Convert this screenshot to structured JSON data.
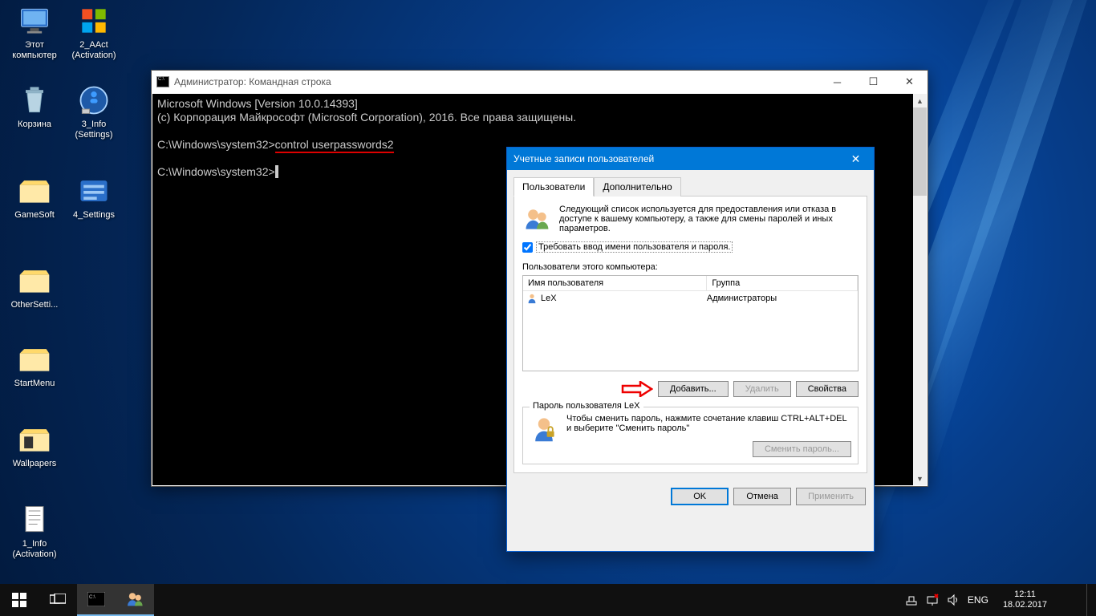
{
  "desktop_icons": [
    {
      "label": "Этот компьютер"
    },
    {
      "label": "2_AAct (Activation)"
    },
    {
      "label": "Корзина"
    },
    {
      "label": "3_Info (Settings)"
    },
    {
      "label": "GameSoft"
    },
    {
      "label": "4_Settings"
    },
    {
      "label": "OtherSetti..."
    },
    {
      "label": "StartMenu"
    },
    {
      "label": "Wallpapers"
    },
    {
      "label": "1_Info (Activation)"
    }
  ],
  "cmd": {
    "title": "Администратор: Командная строка",
    "line1": "Microsoft Windows [Version 10.0.14393]",
    "line2": "(c) Корпорация Майкрософт (Microsoft Corporation), 2016. Все права защищены.",
    "prompt1_prefix": "C:\\Windows\\system32>",
    "prompt1_cmd": "control userpasswords2",
    "prompt2": "C:\\Windows\\system32>"
  },
  "dialog": {
    "title": "Учетные записи пользователей",
    "tab_users": "Пользователи",
    "tab_advanced": "Дополнительно",
    "intro_text": "Следующий список используется для предоставления или отказа в доступе к вашему компьютеру, а также для смены паролей и иных параметров.",
    "checkbox_label": "Требовать ввод имени пользователя и пароля.",
    "list_label": "Пользователи этого компьютера:",
    "col_user": "Имя пользователя",
    "col_group": "Группа",
    "row_user": "LeX",
    "row_group": "Администраторы",
    "btn_add": "Добавить...",
    "btn_remove": "Удалить",
    "btn_props": "Свойства",
    "pass_legend": "Пароль пользователя LeX",
    "pass_text": "Чтобы сменить пароль, нажмите сочетание клавиш CTRL+ALT+DEL и выберите \"Сменить пароль\"",
    "btn_change_pass": "Сменить пароль...",
    "btn_ok": "OK",
    "btn_cancel": "Отмена",
    "btn_apply": "Применить"
  },
  "taskbar": {
    "lang": "ENG",
    "time": "12:11",
    "date": "18.02.2017"
  }
}
